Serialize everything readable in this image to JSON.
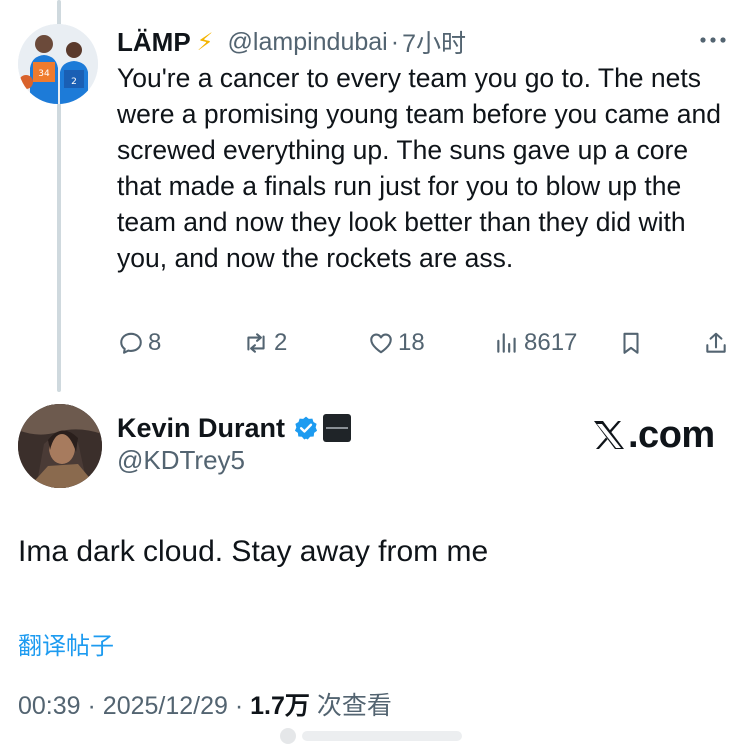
{
  "reply": {
    "name": "LÄMP",
    "emoji": "⚡",
    "handle": "@lampindubai",
    "separator": "·",
    "time": "7小时",
    "text": "You're a cancer to every team you go to. The nets were a promising young team before you came and screwed everything up. The suns gave up a core that made a finals run just for you to blow up the team and now they look better than they did with you, and now the rockets are ass.",
    "jersey_left": "34",
    "jersey_right": "2",
    "actions": {
      "replies": "8",
      "reposts": "2",
      "likes": "18",
      "views": "8617"
    }
  },
  "post": {
    "name": "Kevin Durant",
    "handle": "@KDTrey5",
    "text": "Ima dark cloud. Stay away from me",
    "translate_label": "翻译帖子",
    "time": "00:39",
    "sep1": "·",
    "date": "2025/12/29",
    "sep2": "·",
    "views_count": "1.7万",
    "views_label": "次查看"
  },
  "brand": {
    "label": ".com"
  },
  "colors": {
    "text": "#0f1419",
    "secondary": "#536471",
    "link": "#1d9bf0",
    "verified": "#1d9bf0",
    "thread_line": "#cfd9de"
  },
  "icons": [
    "more-icon",
    "reply-icon",
    "repost-icon",
    "like-icon",
    "views-icon",
    "bookmark-icon",
    "share-icon",
    "verified-badge-icon",
    "x-logo-icon"
  ]
}
